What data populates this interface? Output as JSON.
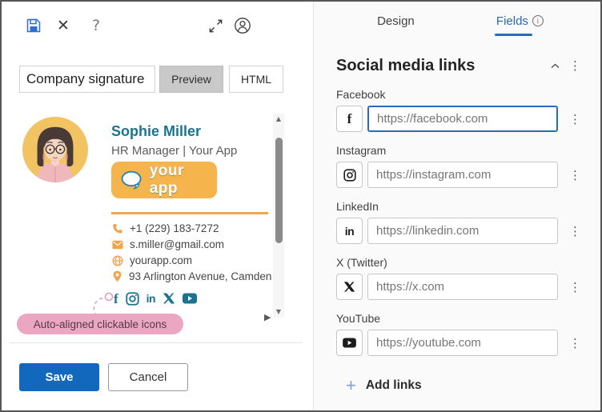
{
  "colors": {
    "accent_blue": "#1168bd",
    "tab_blue": "#2569bd",
    "focus_blue": "#2b6cb8",
    "teal": "#1b7392",
    "orange": "#f2a74e",
    "logo_yellow": "#f6b44d",
    "badge_pink": "#eba7c2",
    "preview_gray": "#c9c9c9"
  },
  "icons": {
    "close": "✕",
    "help": "?",
    "kebab": "⋮",
    "plus": "+",
    "scroll_up": "▲",
    "scroll_down": "▼",
    "play_right": "▶",
    "info": "i",
    "facebook_f": "f",
    "linkedin_in": "in"
  },
  "editor": {
    "signature_name_value": "Company signature",
    "preview_label": "Preview",
    "html_label": "HTML"
  },
  "signature": {
    "name": "Sophie Miller",
    "title": "HR Manager | Your App",
    "logo_text": "your app",
    "contacts": [
      {
        "icon": "phone-icon",
        "text": "+1 (229) 183-7272"
      },
      {
        "icon": "mail-icon",
        "text": "s.miller@gmail.com"
      },
      {
        "icon": "globe-icon",
        "text": "yourapp.com"
      },
      {
        "icon": "location-icon",
        "text": "93 Arlington Avenue, Camden"
      }
    ],
    "social_icons": [
      "facebook",
      "instagram",
      "linkedin",
      "x",
      "youtube"
    ]
  },
  "callout": {
    "label": "Auto-aligned clickable icons"
  },
  "footer": {
    "save_label": "Save",
    "cancel_label": "Cancel"
  },
  "panel": {
    "tabs": [
      {
        "label": "Design"
      },
      {
        "label": "Fields"
      }
    ],
    "active_tab": "Fields",
    "section_title": "Social media links",
    "fields": [
      {
        "label": "Facebook",
        "placeholder": "https://facebook.com",
        "icon": "facebook-icon",
        "focused": true
      },
      {
        "label": "Instagram",
        "placeholder": "https://instagram.com",
        "icon": "instagram-icon",
        "focused": false
      },
      {
        "label": "LinkedIn",
        "placeholder": "https://linkedin.com",
        "icon": "linkedin-icon",
        "focused": false
      },
      {
        "label": "X (Twitter)",
        "placeholder": "https://x.com",
        "icon": "x-icon",
        "focused": false
      },
      {
        "label": "YouTube",
        "placeholder": "https://youtube.com",
        "icon": "youtube-icon",
        "focused": false
      }
    ],
    "add_links_label": "Add links"
  }
}
